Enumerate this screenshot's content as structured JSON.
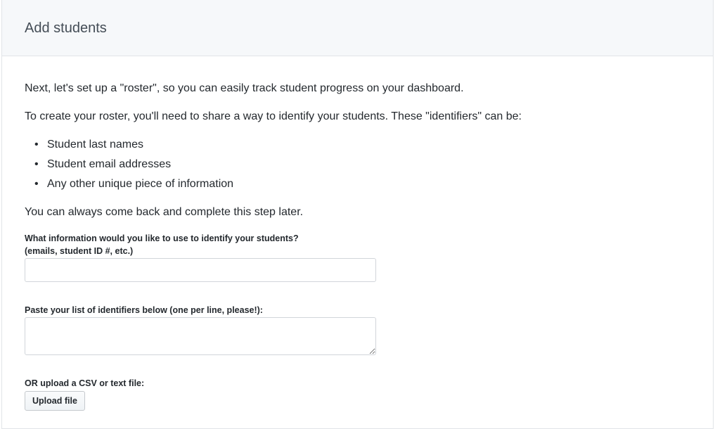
{
  "header": {
    "title": "Add students"
  },
  "intro": {
    "line1": "Next, let's set up a \"roster\", so you can easily track student progress on your dashboard.",
    "line2": "To create your roster, you'll need to share a way to identify your students. These \"identifiers\" can be:",
    "identifier_options": [
      "Student last names",
      "Student email addresses",
      "Any other unique piece of information"
    ],
    "line3": "You can always come back and complete this step later."
  },
  "identifier_type": {
    "label_line1": "What information would you like to use to identify your students?",
    "label_line2": "(emails, student ID #, etc.)",
    "value": "",
    "placeholder": ""
  },
  "identifier_list": {
    "label": "Paste your list of identifiers below (one per line, please!):",
    "value": "",
    "placeholder": ""
  },
  "upload": {
    "label": "OR upload a CSV or text file:",
    "button_label": "Upload file"
  }
}
